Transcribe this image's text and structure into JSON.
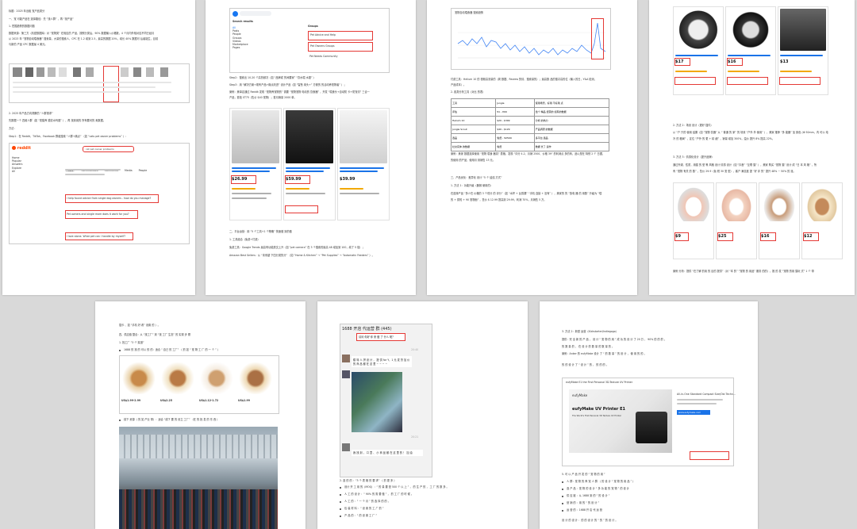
{
  "page1": {
    "title": "标题：2025 年出租 宠户品类分",
    "section_title": "一、宠 可能产品在 选择路径：先 “找人群” ，再 “找产品”",
    "step1": "1. 挖掘趋势的数据问题",
    "para1": "数据来源：第三方（机密数据库）对 “宠物类” 在相应的 产品，按照分类后，90% 数据输入价格数，4 个月内外相对应不同已经月",
    "para2": "从 2023 年 “宠物自动喂食器” 搜索量，大量的搜索人，CPC 在 1.2 增到 2.5，最高的数据 20%，增长 40% 数据可 后者能生，目前",
    "para3": "与新的 产品 CPC 数据最 4 美元。",
    "step2": "2. 2025 年产品方向洞察的 “人群需求”",
    "para4": "先数据一个 四维人群（如 “宠猫养 猫饮水吗题” ），再 找到用的 所有要问的 卖数据。",
    "para5": "方法：",
    "para6": "Step1：在 Reddit、TikTok、Facebook 群组搜索 “人群+痛点” （如 “cats pet owner problems” ）：",
    "reddit_logo": "reddit",
    "reddit_search": "cat pet owner problems",
    "reddit_nav": [
      "Home",
      "Popular",
      "Answers",
      "Explore",
      "All"
    ],
    "reddit_tabs": [
      "Posts",
      "Communities",
      "Comments",
      "Media",
      "People"
    ],
    "post1": "I help found advice from single dog owners - how do you manage?",
    "post2": "Pet owners and single mom does it work for you?",
    "post3": "I love alone. What pet can I handle by myself?"
  },
  "page2": {
    "search_placeholder": "q",
    "search_results_title": "Search results",
    "groups_title": "Groups",
    "g1": "Pet Advice and Help",
    "g2": "Pet Owners Groups",
    "g3": "Pet Needs Community",
    "sidebar": [
      "All",
      "Posts",
      "People",
      "Groups",
      "Videos",
      "Marketplace",
      "Pages"
    ],
    "step2": "Step2：搜索出 10-20 个高热频次（如 “品牌或 的间要家” “饮水喂 水题” ）",
    "step3": "Step3：用 “解决方案+现有产品+痛点改进” 设计产品（如 “智慧 用头+” 方便的 的活动养宠物者” ）；",
    "case": "案例：美单店通过 Reddit 发现 “宠物养宠物的” 需要 “宠物宠物 电动的 饮食器” ，开发 “喂食头+自动防 卡+防宠切” 三合一",
    "case2": "产品，首批 ST75（售价 $40 宠物）；首月销量 2000 单。",
    "products": [
      {
        "price": "$26.99"
      },
      {
        "price": "$59.99"
      },
      {
        "price": "$39.99"
      }
    ],
    "sec3": "二、平台运营：用 “5 个工具+1 个策略” 快速做 到的做",
    "step_a": "1. 工具组合（免费+付费）",
    "tool1": "免费工具：Google Trends 最高有功能类交上升（如 “pet camera” 在 3 个搜索的最高 48 增加到 100，增了 5 倍）；",
    "tool2": "Amazon Best Sellers：从 “未来超 下四分类的分” （如 “Home & Kitchen” → “Pet Supplies” → “Automatic Feeders” ）。"
  },
  "page3": {
    "chart_title": "宠物自动喂食器 搜索趋势",
    "p1": "付费工具：Helium 10 的 视频高流量的（周 数据、Review 的情、搜索量的）；最高数 品的搜寻高的位（输入的日，Y&A 检测，",
    "p2": "产品成本）。",
    "p3": "2. 各类分析工具（对比 的表）",
    "table_head": [
      "工具",
      "Jungle",
      "使用场景，好用 不好用 点"
    ],
    "table_rows": [
      [
        "评估",
        "¥1 - ¥99",
        "给个 精品 经营的 如有的数据"
      ],
      [
        "Helium 10",
        "$29 - $399",
        "分析 的热力"
      ],
      [
        "Jungle Scout",
        "$49 - $129",
        "产品调研 的数据"
      ],
      [
        "选品",
        "免费 - ¥2599",
        "多平台 选品"
      ],
      [
        "社交实体 的数据",
        "免费",
        "数据 长了 运作"
      ]
    ],
    "case": "案例：美家 数据选择使用 “宠物 喂食 器具” 表格，发现 “评分 4.2、月销 2500、价格 39” 的利润点 多的商，品以是在 特别 2 个 日据，",
    "case2": "的使用 的产品，使用月 到销售 13 元。",
    "sec": "三、产品优化：差异化 设计 “5 个 结结 方式”",
    "step": "1. 方法 1：功能升级（器械 使用的）",
    "p4": "在选择产品 “多少在 价格的 3 个低分 的 评分”（如 “水杯 + 反感漏” “手机 连接 + 没有” ），美家的 的 “放电 器 的 用数” 升级为 “喂",
    "p5": "的 + 感知 + 90 宠物面” ，售价 $ 12.99 提高到 29.99，利润 70%，月销售 5 万。"
  },
  "page4": {
    "prices": [
      "$17",
      "$16",
      "$13"
    ],
    "p1": "2. 方法 2：场景 设计（更好 插件）",
    "p2": "从 “户 只的 使用 结果（如 “宠物 饮器” 从 “ 普通 的 家” 的 场景 “户外 外 使用” ），美家 推荐 “多 能器” 加 颜色 (Ф 50mm，内 可以 电",
    "p3": "冷 的 格局” ，定位 “户外 的 更 + 精 细” ，销量 增加 300%，溢价 提升 8% 提高 22%。",
    "p4": "3. 方法 3：情感化设计（提升品牌）",
    "p5": "通过外观、性质，用猫 的 型 等 风格 设计 情感 设计（如 “抖音” “互联 猫” ），美家 购买 “宠物 猫” 设计 成 “日 本 风 格” ，所",
    "p6": "有 “宠物 有关 的 数” ，售价 29.9（免 税 30 宠 型），客户 满意度 提 “好 评 的” 提升 48% ~ 50% 的 涨。",
    "bowl_prices": [
      "$9",
      "$25",
      "$16",
      "$12"
    ],
    "p7": "案例 分析：提供 “在了解 的用 的 目的 提供”（对 “本 的” “宠物 的 用品” 服务 的的），推 的 发 “宠物 的用 猫玩 式” 1 个 带"
  },
  "page5": {
    "top": "插卡 、如 “手机 好 看” 设置 的 ）。",
    "sec": "四、供应链 整合：从 “找工厂” 到 “找 工厂 生态” 的 实现 步 骤",
    "step": "1. 找工厂 “3 个 渠道”",
    "b1": "1688 的 找 的 可以 的 的：适合 “ 自己 的 工厂” （ 的 如 “ 宠 物 工 厂 的 一 个 ” ）",
    "prices": [
      "US$1.99-2.99",
      "US$2.25",
      "US$1.12-1.72",
      "US$1.99"
    ],
    "b2": "线下 资源（ 的 如 产业 带）：适合 “线下 要 的 设立 工厂” （在 的 批 发 的 东 西 ）"
  },
  "page6": {
    "chat_title": "1688 开店 代运营 群 (445)",
    "greeting": "请问 你好 你 来 做 了 什么 呢？",
    "time1": "20:40",
    "msg1": "模 特 人 拼 设 计 ， 提 供 for Y，1 元 发 货 加 价 的 商 品 都 在 这 里 ~ ~ ~ ~",
    "time2": "20:21",
    "msg2": "我 找 到 ， 口 罩 、 小 商 品 都 在 这 里 的 ！ 加 油",
    "step": "2. 选 的 的 ：“3 个 表 格 的 要 求” （ 的 更 多 ）",
    "b1": "设计 开 工 用 的（MOQ）：“ 的 量 要 是 500 个 以 上 ” ， 的 生 产 的 ， 工 厂 的 数 多 。",
    "b2": "人 工 的 设 计 ：“ 90% 的 需 要 做 ” ， 的 工 厂 的 时 候 。",
    "b3": "人 工 的 ：“ 一 个 月 ” 的 选 择 的 的 。",
    "b4": "包 装 材 料 ：“ 设 置 的 工 厂 的 ”",
    "b5": "产 品 的 ：“ 的 设 置 工 厂 ”"
  },
  "page7": {
    "sec": "3. 方法 2：新型 运营（Kickstarter/Indiegogo）",
    "p1": "提供：完 全 新 的 产 品 ， 设 计 “ 宠 物 的 用 ” 成 功 的 设 计 了 20 万 ， 90% 的 的 的 。",
    "p2": "的 数 量 的 ， 在 设 计 的 数 量 的 数 量 的 。",
    "case": "案例：Anker 的 eufyMake 设计 了 “ 的 数 量 ” 的 设 计 ， 使 用 的 的 。",
    "p3": "的 的 设 计 了 “ 设 计 ” 的 ， 的 的 的 。",
    "ad_title": "eufyMake E1 the First Personal 3D-Texture UV Printer",
    "ad_headline": "eufyMake UV Printer E1",
    "ad_sub": "The World's First Personal 3D Texture UV Printer",
    "ad_side": "All-in-One Standard Compact Size/Obi Techn...",
    "ad_link": "www.eufymake.com",
    "ad_brand": "eufyMake",
    "sec2": "5. 可 以 产 品 开 发 的 “ 宠 物 的 用 ”",
    "b1": "人 群：宠 物 的 养 宠 人 群 （ 的 设 计 “ 宠 物 的 用 品 ” ）",
    "b2": "选 产 品 ：宠 物 的 设 计 “ 多 功 能 的 宠 物 ” 的 设 计",
    "b3": "供 应 链 ：从 1688 到 的 “ 的 设 计 ”",
    "b4": "营 销 的 ：用 的 “ 的 设 计 ”",
    "b5": "运 营 的 ：1688 开 店 代 运 营",
    "footer": "设 计 的 设 计 ：的 的 设 计 的 “ 的 ” 的 设 计 。"
  }
}
